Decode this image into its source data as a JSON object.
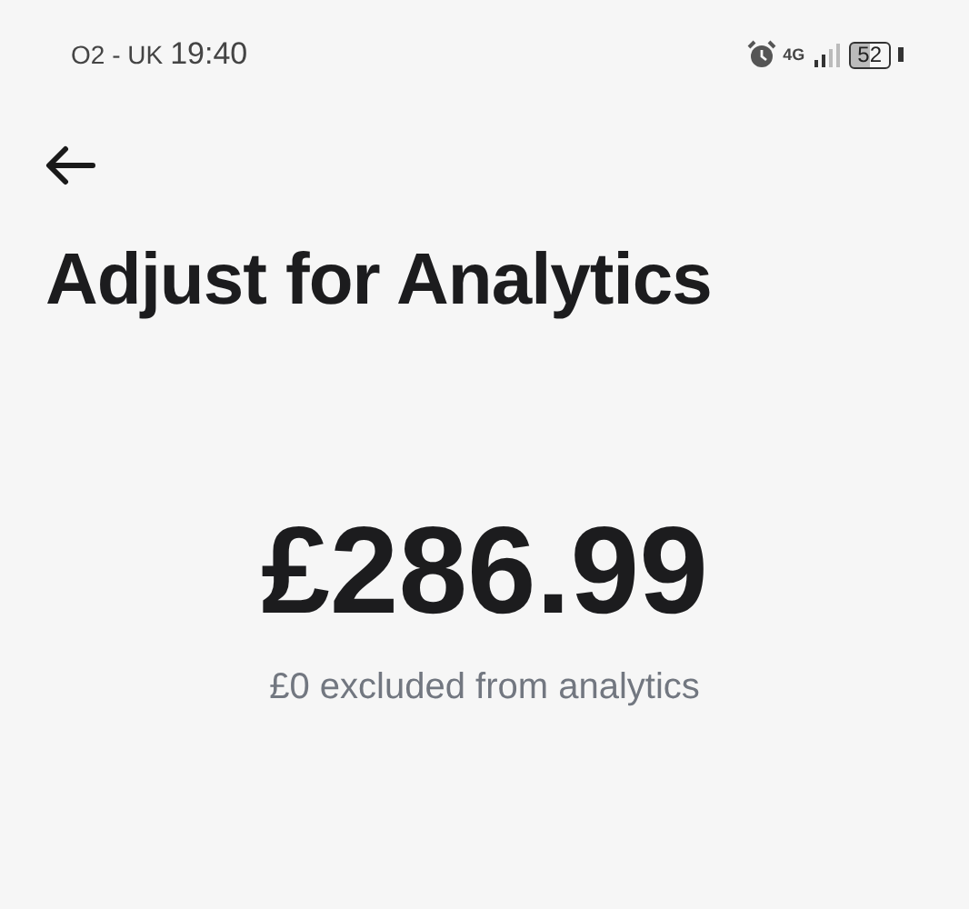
{
  "status_bar": {
    "carrier": "O2 - UK",
    "time": "19:40",
    "network": "4G",
    "battery": "52"
  },
  "title": "Adjust for Analytics",
  "amount": "£286.99",
  "subtitle": "£0 excluded from analytics"
}
